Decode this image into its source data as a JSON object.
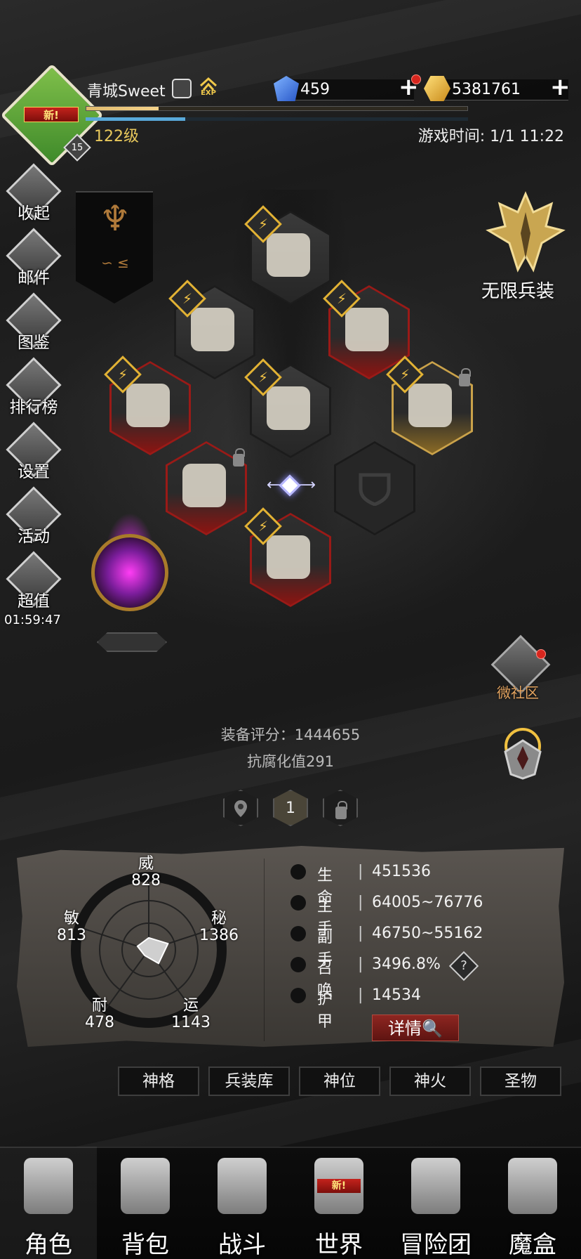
{
  "header": {
    "player_name": "青城Sweet",
    "avatar_badge": "新!",
    "avatar_level": "15",
    "exp_icon_label": "EXP",
    "level": "122级",
    "gems": "459",
    "gold": "5381761",
    "game_time": "游戏时间: 1/1 11:22",
    "exp_progress": 0.19,
    "hp_progress": 0.26
  },
  "left_menu": {
    "items": [
      {
        "label": "收起",
        "icon": "collapse-icon"
      },
      {
        "label": "邮件",
        "icon": "mail-icon"
      },
      {
        "label": "图鉴",
        "icon": "book-icon"
      },
      {
        "label": "排行榜",
        "icon": "ranking-icon"
      },
      {
        "label": "设置",
        "icon": "gear-icon"
      },
      {
        "label": "活动",
        "icon": "event-icon"
      },
      {
        "label": "超值",
        "icon": "gift-icon"
      }
    ],
    "timer": "01:59:47"
  },
  "infinite_equip": {
    "label": "无限兵装"
  },
  "equipment": {
    "quality_glyph": "⚡",
    "swap_arrows": "⟵    ⟶"
  },
  "community": {
    "label": "微社区"
  },
  "score": {
    "equip_score": "装备评分：1444655",
    "corruption": "抗腐化值291"
  },
  "loadout": {
    "selected": "1"
  },
  "radar": {
    "stats": [
      {
        "name": "威",
        "value": "828"
      },
      {
        "name": "秘",
        "value": "1386"
      },
      {
        "name": "运",
        "value": "1143"
      },
      {
        "name": "耐",
        "value": "478"
      },
      {
        "name": "敏",
        "value": "813"
      }
    ]
  },
  "attributes": {
    "separator": "|",
    "rows": [
      {
        "name": "生命",
        "value": "451536",
        "icon": "heart-icon"
      },
      {
        "name": "主手",
        "value": "64005~76776",
        "icon": "sword-icon"
      },
      {
        "name": "副手",
        "value": "46750~55162",
        "icon": "dagger-icon"
      },
      {
        "name": "召唤",
        "value": "3496.8%",
        "icon": "summon-icon"
      },
      {
        "name": "护甲",
        "value": "14534",
        "icon": "armor-icon"
      }
    ],
    "help": "?",
    "detail_button": "详情🔍"
  },
  "subtabs": [
    "神格",
    "兵装库",
    "神位",
    "神火",
    "圣物"
  ],
  "bottom_nav": {
    "items": [
      {
        "label": "角色",
        "icon": "helmet-icon"
      },
      {
        "label": "背包",
        "icon": "backpack-icon"
      },
      {
        "label": "战斗",
        "icon": "battle-icon"
      },
      {
        "label": "世界",
        "icon": "world-map-icon"
      },
      {
        "label": "冒险团",
        "icon": "castle-icon"
      },
      {
        "label": "魔盒",
        "icon": "magic-box-icon"
      }
    ],
    "world_badge": "新!",
    "active": "角色"
  },
  "colors": {
    "accent_gold": "#e8c85c",
    "quality_red": "#9a1a17",
    "quality_gold": "#caa24a",
    "community_orange": "#e3a35f"
  }
}
